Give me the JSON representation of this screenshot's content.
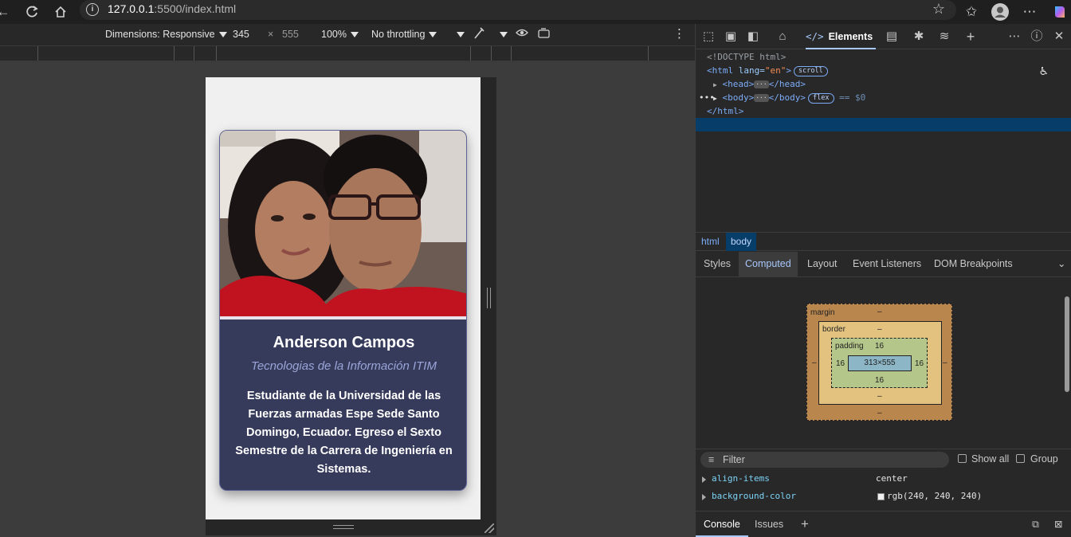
{
  "browser": {
    "url_host": "127.0.0.1",
    "url_rest": ":5500/index.html"
  },
  "device_toolbar": {
    "dimensions_label": "Dimensions: Responsive",
    "width": "345",
    "height": "555",
    "times": "×",
    "zoom": "100%",
    "throttling": "No throttling"
  },
  "card": {
    "name": "Anderson Campos",
    "role": "Tecnologias de la Información ITIM",
    "description": "Estudiante de la Universidad de las Fuerzas armadas Espe Sede Santo Domingo, Ecuador. Egreso el Sexto Semestre de la Carrera de Ingeniería en Sistemas.",
    "photo_alt": "photo-of-two-people"
  },
  "devtools": {
    "elements_tab": "Elements",
    "elements_code": "</>",
    "dom": {
      "doctype": "<!DOCTYPE html>",
      "html_open_tag": "<html",
      "html_attr": " lang=",
      "html_attr_val": "\"en\"",
      "html_close_bracket": ">",
      "scroll_pill": "scroll",
      "head_line": "<head>",
      "head_end": "</head>",
      "body_line": "<body>",
      "body_end": "</body>",
      "flex_pill": "flex",
      "dollar": "== $0",
      "html_close": "</html>",
      "ellipsis": "···",
      "row_ellipsis": "•••"
    },
    "breadcrumbs": [
      "html",
      "body"
    ],
    "sub_tabs": [
      "Styles",
      "Computed",
      "Layout",
      "Event Listeners",
      "DOM Breakpoints"
    ],
    "box_model": {
      "margin_label": "margin",
      "border_label": "border",
      "padding_label": "padding",
      "content": "313×555",
      "padding_value": "16",
      "dash": "–"
    },
    "filter_placeholder": "Filter",
    "show_all": "Show all",
    "group": "Group",
    "properties": [
      {
        "name": "align-items",
        "value": "center"
      },
      {
        "name": "background-color",
        "value": "rgb(240, 240, 240)"
      }
    ],
    "console_tabs": [
      "Console",
      "Issues"
    ]
  },
  "colors": {
    "card_bg": "#363a5b",
    "selection": "#073d69",
    "accent": "#a8c7fa"
  }
}
